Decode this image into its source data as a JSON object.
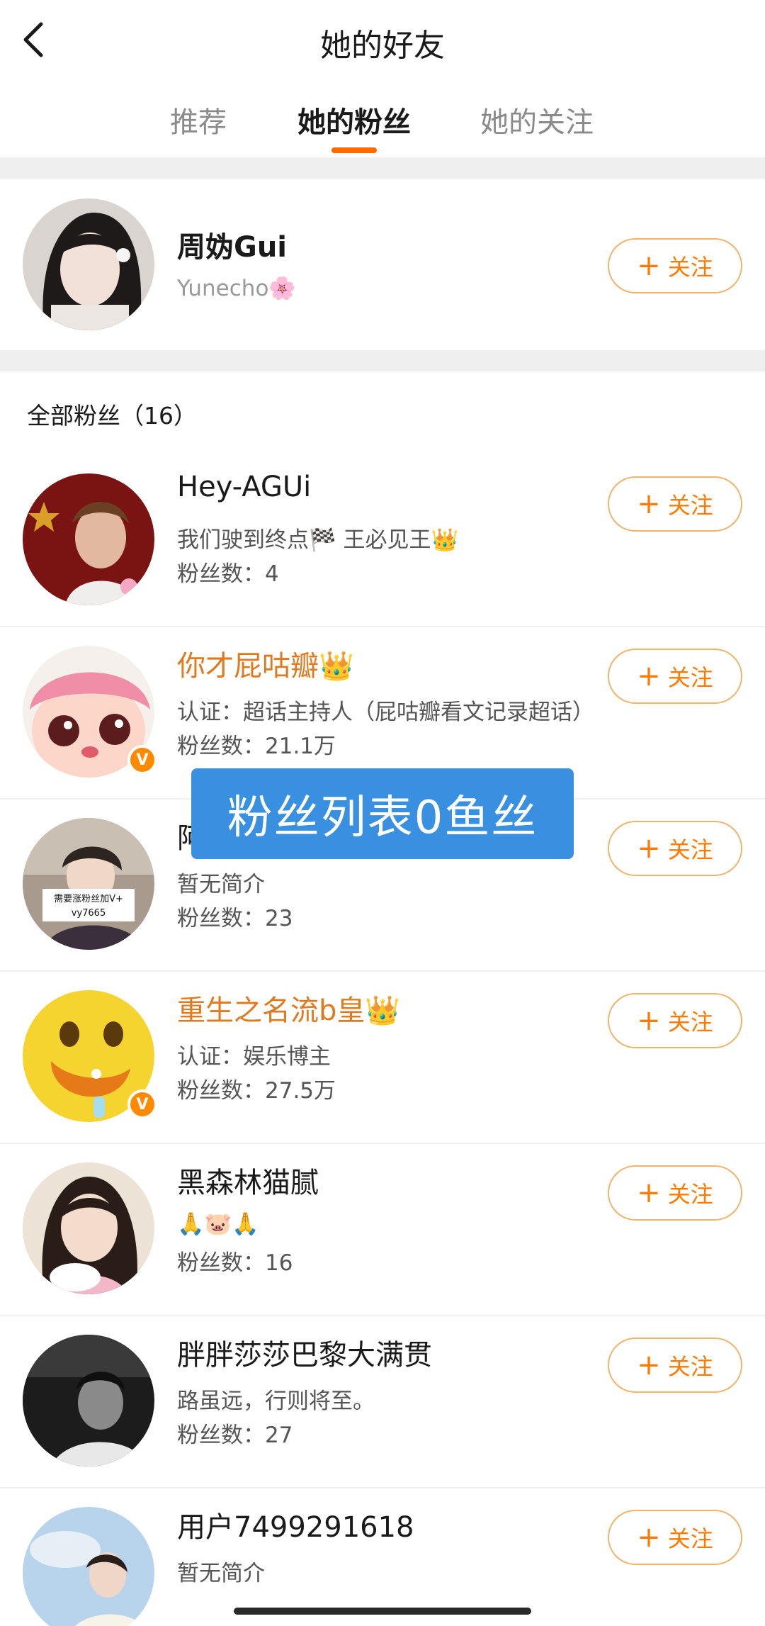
{
  "header": {
    "title": "她的好友",
    "back_icon": "chevron-left-icon"
  },
  "tabs": [
    {
      "label": "推荐",
      "active": false
    },
    {
      "label": "她的粉丝",
      "active": true
    },
    {
      "label": "她的关注",
      "active": false
    }
  ],
  "accent_color": "#ff6a00",
  "featured_user": {
    "name": "周妫Gui",
    "subtitle": "Yunecho🌸",
    "follow_label": "+ 关注"
  },
  "section": {
    "title": "全部粉丝（16）"
  },
  "follow_button": {
    "plus": "+",
    "label": "关注"
  },
  "fans": [
    {
      "name": "Hey-AGUi",
      "bio": "我们驶到终点🏁 王必见王👑",
      "fans": "粉丝数：4",
      "verified": false,
      "name_color": "default"
    },
    {
      "name": "你才屁咕瓣👑",
      "bio": "认证：超话主持人（屁咕瓣看文记录超话）",
      "fans": "粉丝数：21.1万",
      "verified": true,
      "name_color": "orange"
    },
    {
      "name": "阿…_",
      "bio": "暂无简介",
      "fans": "粉丝数：23",
      "verified": false,
      "name_color": "default",
      "avatar_caption_1": "需要涨粉丝加V+",
      "avatar_caption_2": "vy7665"
    },
    {
      "name": "重生之名流b皇👑",
      "bio": "认证：娱乐博主",
      "fans": "粉丝数：27.5万",
      "verified": true,
      "name_color": "orange"
    },
    {
      "name": "黑森林猫腻",
      "bio": "🙏🐷🙏",
      "fans": "粉丝数：16",
      "verified": false,
      "name_color": "default"
    },
    {
      "name": "胖胖莎莎巴黎大满贯",
      "bio": "路虽远，行则将至。",
      "fans": "粉丝数：27",
      "verified": false,
      "name_color": "default"
    },
    {
      "name": "用户7499291618",
      "bio": "暂无简介",
      "fans": "",
      "verified": false,
      "name_color": "default"
    }
  ],
  "overlay": {
    "text": "粉丝列表0鱼丝",
    "color": "#3a90e0"
  }
}
